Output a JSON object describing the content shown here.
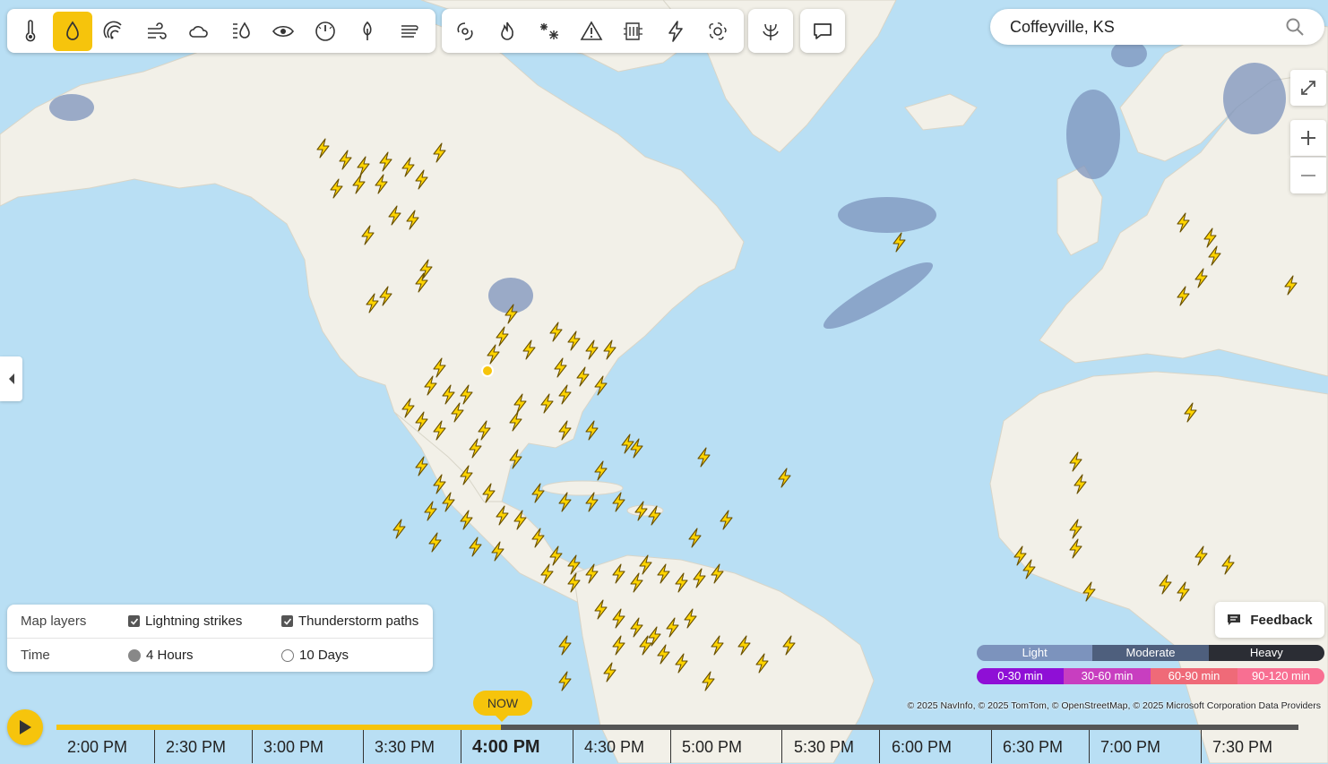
{
  "toolbar": {
    "group1": [
      "thermometer-icon",
      "droplet-icon",
      "radar-icon",
      "wind-icon",
      "cloud-icon",
      "humidity-icon",
      "eye-icon",
      "pressure-gauge-icon",
      "tree-icon",
      "fog-icon"
    ],
    "group2": [
      "hurricane-icon",
      "fire-icon",
      "snowflake-icon",
      "warning-icon",
      "air-quality-icon",
      "lightning-icon",
      "pollen-icon"
    ],
    "group3": [
      "plant-icon"
    ],
    "group4": [
      "chat-icon"
    ],
    "active_index": 1
  },
  "search": {
    "value": "Coffeyville, KS"
  },
  "layers_panel": {
    "map_layers_label": "Map layers",
    "lightning_label": "Lightning strikes",
    "thunderstorm_label": "Thunderstorm paths",
    "time_label": "Time",
    "option_4h": "4 Hours",
    "option_10d": "10 Days"
  },
  "feedback": {
    "label": "Feedback"
  },
  "legend": {
    "intensity": [
      {
        "label": "Light",
        "color": "#7c93bd"
      },
      {
        "label": "Moderate",
        "color": "#4e5f7d"
      },
      {
        "label": "Heavy",
        "color": "#2b2d34"
      }
    ],
    "duration": [
      {
        "label": "0-30 min",
        "color": "#8f0fd6"
      },
      {
        "label": "30-60 min",
        "color": "#c83ec0"
      },
      {
        "label": "60-90 min",
        "color": "#ef6a78"
      },
      {
        "label": "90-120 min",
        "color": "#f86f92"
      }
    ]
  },
  "credits": "© 2025 NavInfo, © 2025 TomTom,   © OpenStreetMap, © 2025 Microsoft Corporation  Data Providers",
  "timeline": {
    "now_label": "NOW",
    "progress_fraction": 0.358,
    "ticks": [
      "2:00 PM",
      "2:30 PM",
      "3:00 PM",
      "3:30 PM",
      "4:00 PM",
      "4:30 PM",
      "5:00 PM",
      "5:30 PM",
      "6:00 PM",
      "6:30 PM",
      "7:00 PM",
      "7:30 PM"
    ],
    "current_index": 4
  },
  "colors": {
    "accent": "#f6c40c",
    "ocean": "#b9dff4",
    "land": "#f3f1ea",
    "bolt": "#ffd400"
  }
}
